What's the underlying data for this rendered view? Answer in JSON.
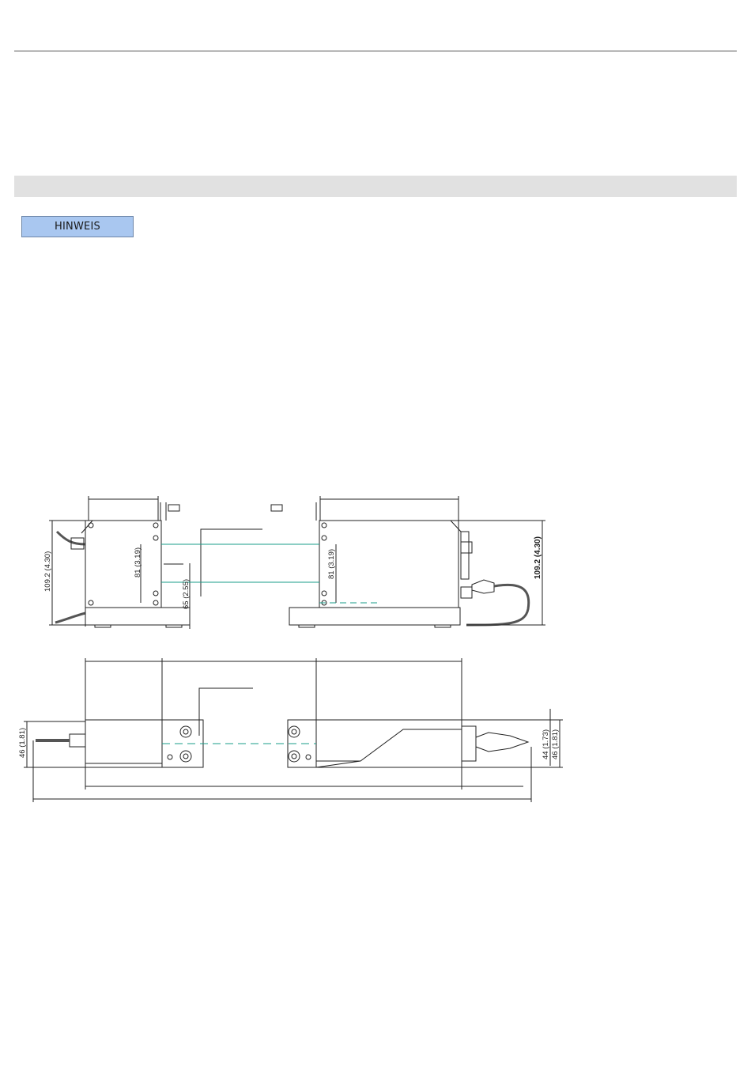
{
  "header": {
    "rule": "top-rule"
  },
  "section": {
    "band": "gray-section-band"
  },
  "notice": {
    "label": "HINWEIS",
    "color": "#a9c7f0"
  },
  "drawing": {
    "dims": {
      "left_height": "109.2 (4.30)",
      "left_81": "81 (3.19)",
      "left_65": "65 (2.55)",
      "right_81": "81 (3.19)",
      "right_height": "109.2 (4.30)",
      "left_side_46": "46 (1.81)",
      "right_44": "44 (1.73)",
      "right_46": "46 (1.81)"
    },
    "colors": {
      "beam": "#1a9e8a",
      "line": "#222222"
    }
  }
}
